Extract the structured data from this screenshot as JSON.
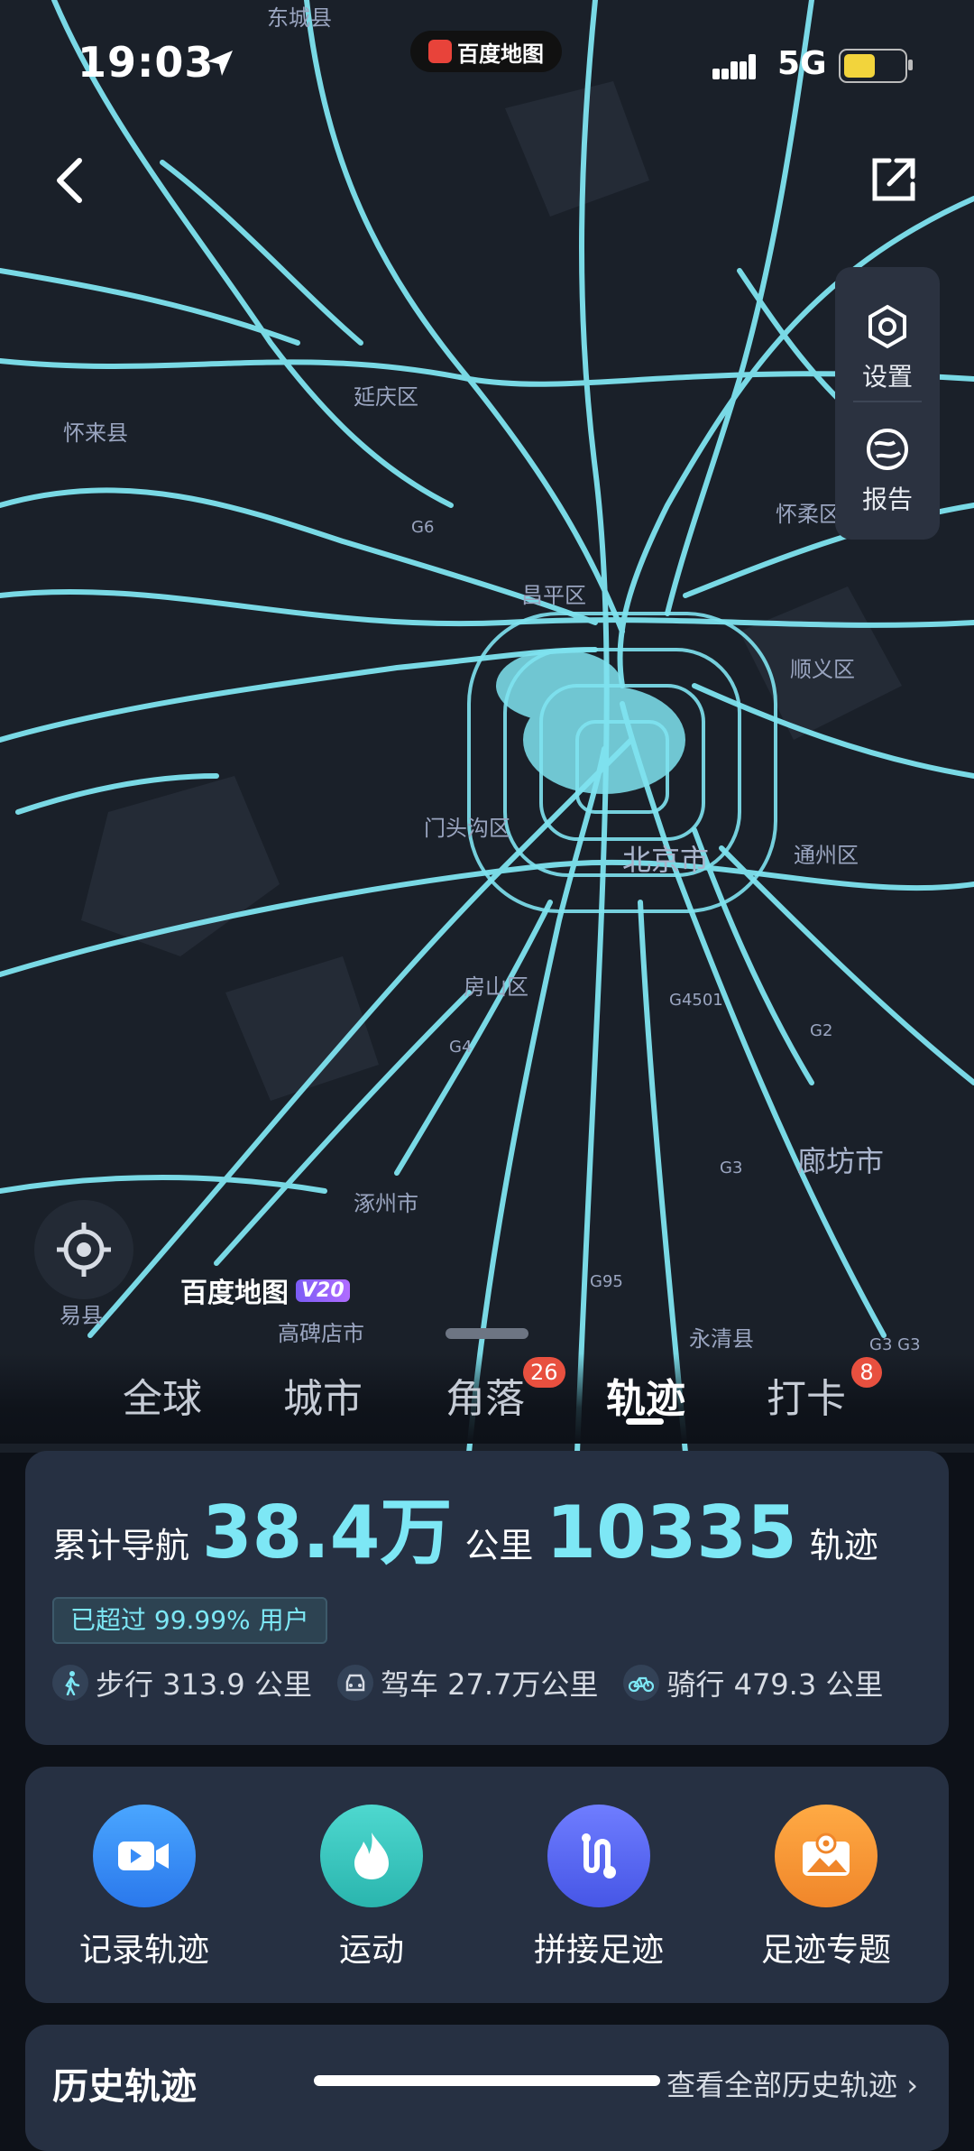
{
  "status_bar": {
    "time": "19:03",
    "app_name": "百度地图",
    "network": "5G"
  },
  "side_panel": {
    "settings_label": "设置",
    "report_label": "报告"
  },
  "map": {
    "labels": [
      {
        "id": "l1",
        "text": "东城县"
      },
      {
        "id": "l2",
        "text": "延庆区"
      },
      {
        "id": "l3",
        "text": "怀来县"
      },
      {
        "id": "l4",
        "text": "怀柔区"
      },
      {
        "id": "l5",
        "text": "昌平区"
      },
      {
        "id": "l6",
        "text": "顺义区"
      },
      {
        "id": "l7",
        "text": "门头沟区"
      },
      {
        "id": "l8",
        "text": "北京市"
      },
      {
        "id": "l9",
        "text": "通州区"
      },
      {
        "id": "l10",
        "text": "房山区"
      },
      {
        "id": "l11",
        "text": "涿州市"
      },
      {
        "id": "l12",
        "text": "廊坊市"
      },
      {
        "id": "l13",
        "text": "高碑店市"
      },
      {
        "id": "l14",
        "text": "永清县"
      },
      {
        "id": "l15",
        "text": "G6"
      },
      {
        "id": "l16",
        "text": "G4501"
      },
      {
        "id": "l17",
        "text": "G4"
      },
      {
        "id": "l18",
        "text": "G2"
      },
      {
        "id": "l19",
        "text": "G3"
      },
      {
        "id": "l20",
        "text": "G95"
      },
      {
        "id": "l21",
        "text": "G3 G3"
      }
    ],
    "locate_label": "易县",
    "brand": "百度地图",
    "brand_version": "V20"
  },
  "tabs": [
    {
      "label": "全球"
    },
    {
      "label": "城市"
    },
    {
      "label": "角落",
      "badge": "26"
    },
    {
      "label": "轨迹",
      "active": true
    },
    {
      "label": "打卡",
      "badge": "8"
    }
  ],
  "stats": {
    "prefix": "累计导航",
    "distance": "38.4万",
    "distance_unit": "公里",
    "tracks": "10335",
    "tracks_unit": "轨迹",
    "percentile": "已超过 99.99% 用户",
    "walk": "步行 313.9 公里",
    "drive": "驾车 27.7万公里",
    "ride": "骑行 479.3 公里"
  },
  "actions": [
    {
      "label": "记录轨迹",
      "color": "#3a8df7"
    },
    {
      "label": "运动",
      "color": "#3cc6c0"
    },
    {
      "label": "拼接足迹",
      "color": "#5a6cf2"
    },
    {
      "label": "足迹专题",
      "color": "#f3962e"
    }
  ],
  "history": {
    "title": "历史轨迹",
    "link": "查看全部历史轨迹"
  },
  "colors": {
    "track": "#7fe3f0",
    "accent": "#7de7f5",
    "badge": "#e8503f"
  }
}
